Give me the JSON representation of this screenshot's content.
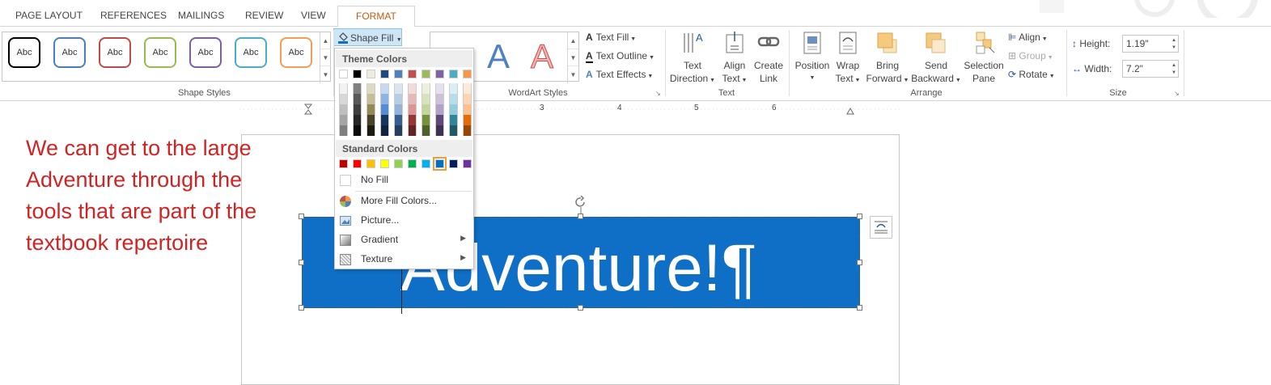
{
  "tabs": [
    {
      "label": "PAGE LAYOUT"
    },
    {
      "label": "REFERENCES"
    },
    {
      "label": "MAILINGS"
    },
    {
      "label": "REVIEW"
    },
    {
      "label": "VIEW"
    },
    {
      "label": "FORMAT",
      "active": true
    }
  ],
  "ribbon": {
    "shape_styles": {
      "label": "Shape Styles",
      "swatch_text": "Abc",
      "swatch_colors": [
        "#000000",
        "#4a7ebb",
        "#be4b48",
        "#98b954",
        "#7d60a0",
        "#4bacc6",
        "#f59d56"
      ],
      "shape_fill_label": "Shape Fill"
    },
    "wordart_styles": {
      "label": "WordArt Styles",
      "letter": "A",
      "text_fill": "Text Fill",
      "text_outline": "Text Outline",
      "text_effects": "Text Effects"
    },
    "text": {
      "label": "Text",
      "text_direction": [
        "Text",
        "Direction"
      ],
      "align_text": [
        "Align",
        "Text"
      ],
      "create_link": [
        "Create",
        "Link"
      ]
    },
    "arrange": {
      "label": "Arrange",
      "position": [
        "Position",
        ""
      ],
      "wrap_text": [
        "Wrap",
        "Text"
      ],
      "bring_forward": [
        "Bring",
        "Forward"
      ],
      "send_backward": [
        "Send",
        "Backward"
      ],
      "selection_pane": [
        "Selection",
        "Pane"
      ],
      "align": "Align",
      "group": "Group",
      "rotate": "Rotate"
    },
    "size": {
      "label": "Size",
      "height_label": "Height:",
      "height_value": "1.19\"",
      "width_label": "Width:",
      "width_value": "7.2\""
    }
  },
  "ruler": {
    "numbers": [
      "3",
      "4",
      "5",
      "6"
    ]
  },
  "document": {
    "annotation": "We can get to the large Adventure through the tools that are part of the textbook repertoire",
    "shape_text": "Adventure!¶",
    "shape_color": "#0f6fc6"
  },
  "shape_fill_menu": {
    "theme_colors_header": "Theme Colors",
    "standard_colors_header": "Standard Colors",
    "theme_top": [
      "#ffffff",
      "#000000",
      "#eeece1",
      "#1f497d",
      "#4f81bd",
      "#c0504d",
      "#9bbb59",
      "#8064a2",
      "#4bacc6",
      "#f79646"
    ],
    "theme_shades": [
      [
        "#f2f2f2",
        "#7f7f7f",
        "#ddd9c3",
        "#c6d9f0",
        "#dbe5f1",
        "#f2dcdb",
        "#ebf1dd",
        "#e5e0ec",
        "#dbeef3",
        "#fdeada"
      ],
      [
        "#d8d8d8",
        "#595959",
        "#c4bd97",
        "#8db3e2",
        "#b8cce4",
        "#e5b9b7",
        "#d7e3bc",
        "#ccc1d9",
        "#b7dde8",
        "#fbd5b5"
      ],
      [
        "#bfbfbf",
        "#3f3f3f",
        "#938953",
        "#548dd4",
        "#95b3d7",
        "#d99694",
        "#c3d69b",
        "#b2a2c7",
        "#92cddc",
        "#fac08f"
      ],
      [
        "#a5a5a5",
        "#262626",
        "#494429",
        "#17365d",
        "#366092",
        "#953734",
        "#76923c",
        "#5f497a",
        "#31859b",
        "#e36c09"
      ],
      [
        "#7f7f7f",
        "#0c0c0c",
        "#1d1b10",
        "#0f243e",
        "#244061",
        "#632423",
        "#4f6128",
        "#3f3151",
        "#205867",
        "#974806"
      ]
    ],
    "standard": [
      "#c00000",
      "#ff0000",
      "#ffc000",
      "#ffff00",
      "#92d050",
      "#00b050",
      "#00b0f0",
      "#0070c0",
      "#002060",
      "#7030a0"
    ],
    "no_fill": "No Fill",
    "more_colors": "More Fill Colors...",
    "picture": "Picture...",
    "gradient": "Gradient",
    "texture": "Texture"
  }
}
